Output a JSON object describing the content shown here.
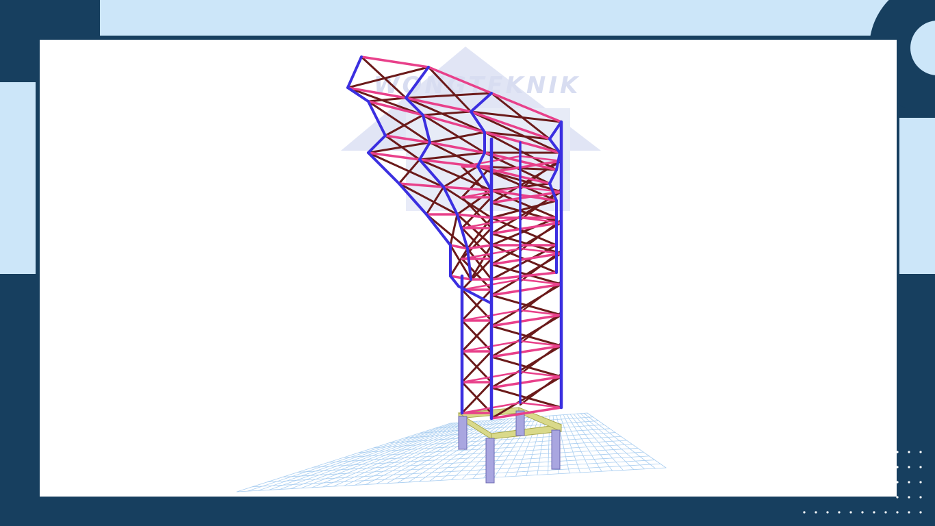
{
  "watermark": {
    "text": "WONGTEKNIK"
  },
  "colors": {
    "background_dark": "#173f5f",
    "background_light": "#cce6f9",
    "canvas": "#ffffff",
    "column": "#3b2fe0",
    "beam": "#e8408a",
    "brace": "#6b1a1a",
    "foundation_beam": "#d9d98a",
    "pedestal": "#a9a6e0",
    "grid": "#a8cdf0",
    "watermark": "#b9c2e6"
  }
}
